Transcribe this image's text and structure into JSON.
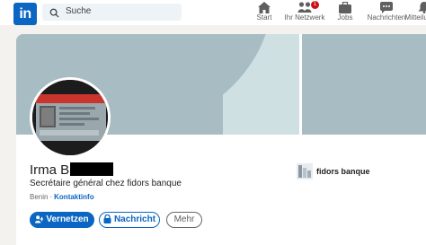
{
  "nav": {
    "logo": "in",
    "search_placeholder": "Suche",
    "items": [
      {
        "label": "Start",
        "icon": "home-icon"
      },
      {
        "label": "Ihr Netzwerk",
        "icon": "network-icon",
        "badge": "1"
      },
      {
        "label": "Jobs",
        "icon": "briefcase-icon"
      },
      {
        "label": "Nachrichten",
        "icon": "messaging-icon"
      },
      {
        "label": "Mitteilungen",
        "icon": "bell-icon"
      }
    ]
  },
  "profile": {
    "name": "Irma B",
    "headline": "Secrétaire général chez fidors banque",
    "location": "Benin",
    "contact_link": "Kontaktinfo",
    "company": "fidors banque"
  },
  "actions": {
    "connect": "Vernetzen",
    "message": "Nachricht",
    "more": "Mehr"
  },
  "colors": {
    "brand": "#0a66c2",
    "banner": "#a8bdc3",
    "badge": "#cc1016"
  }
}
